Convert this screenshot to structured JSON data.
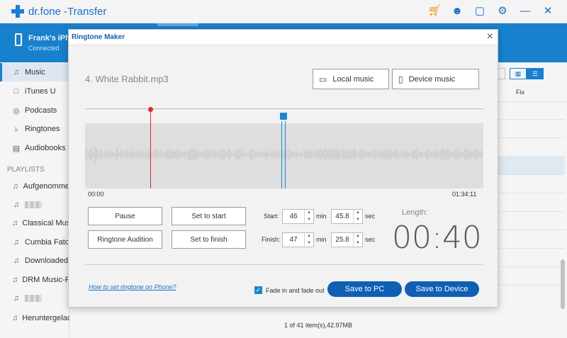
{
  "app": {
    "title": "dr.fone -Transfer"
  },
  "titlebar_icons": [
    "cart-icon",
    "user-icon",
    "feedback-icon",
    "settings-icon",
    "minimize-icon",
    "close-icon"
  ],
  "device": {
    "name": "Frank's iPho",
    "status": "Connected"
  },
  "sidebar": {
    "items": [
      {
        "label": "Music",
        "icon": "music-icon"
      },
      {
        "label": "iTunes U",
        "icon": "itunes-u-icon"
      },
      {
        "label": "Podcasts",
        "icon": "podcast-icon"
      },
      {
        "label": "Ringtones",
        "icon": "bell-icon"
      },
      {
        "label": "Audiobooks",
        "icon": "book-icon"
      }
    ],
    "playlists_heading": "PLAYLISTS",
    "playlists": [
      "Aufgenomme",
      "",
      "Classical Mus",
      "Cumbia Fato",
      "Downloaded",
      "DRM Music-F",
      "",
      "Heruntergeladen"
    ]
  },
  "table": {
    "fix_header": "Fix"
  },
  "status_bar": {
    "text": "1 of 41 item(s),42.97MB"
  },
  "dialog": {
    "title": "Ringtone Maker",
    "file_name": "4. White Rabbit.mp3",
    "local_music_label": "Local music",
    "device_music_label": "Device music",
    "time_start": "00:00",
    "time_end": "01:34:11",
    "pause_label": "Pause",
    "set_start_label": "Set to start",
    "audition_label": "Ringtone Audition",
    "set_finish_label": "Set to finish",
    "start_label": "Start:",
    "start_min": "46",
    "start_sec": "45.8",
    "finish_label": "Finish:",
    "finish_min": "47",
    "finish_sec": "25.8",
    "min_unit": "min",
    "sec_unit": "sec",
    "length_label": "Length:",
    "length_value": "00:40",
    "howto_link": "How to set ringtone on Phone?",
    "fade_label": "Fade in and fade out",
    "fade_checked": true,
    "save_pc_label": "Save to PC",
    "save_device_label": "Save to Device",
    "accent_color": "#1a87d6",
    "button_color": "#0f5fb5"
  }
}
